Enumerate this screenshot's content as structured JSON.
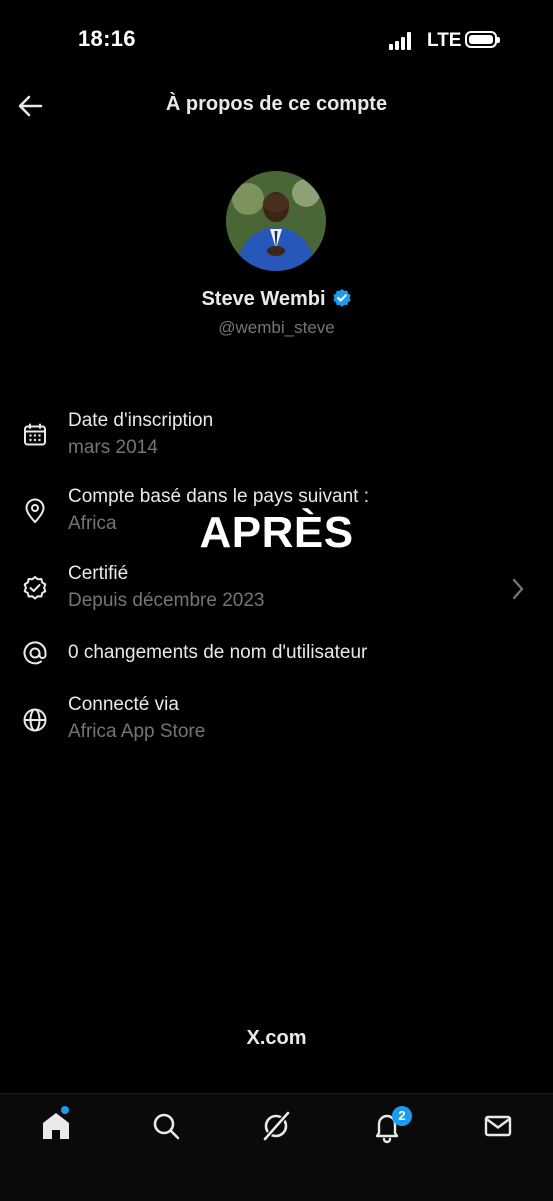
{
  "status_bar": {
    "time": "18:16",
    "network": "LTE"
  },
  "header": {
    "title": "À propos de ce compte",
    "back_icon": "arrow-left-icon"
  },
  "profile": {
    "name": "Steve Wembi",
    "handle": "@wembi_steve",
    "verified": true,
    "verified_color": "#1d9bf0"
  },
  "info_rows": [
    {
      "icon": "calendar-icon",
      "title": "Date d'inscription",
      "subtitle": "mars 2014"
    },
    {
      "icon": "location-pin-icon",
      "title": "Compte basé dans le pays suivant :",
      "subtitle": "Africa"
    },
    {
      "icon": "verified-badge-icon",
      "title": "Certifié",
      "subtitle": "Depuis décembre 2023"
    },
    {
      "icon": "at-sign-icon",
      "title": "0 changements de nom d'utilisateur",
      "subtitle": ""
    },
    {
      "icon": "globe-icon",
      "title": "Connecté via",
      "subtitle": "Africa App Store"
    }
  ],
  "overlay_text": "APRÈS",
  "footer_brand": "X.com",
  "bottom_nav": {
    "items": [
      "home-icon",
      "search-icon",
      "grok-icon",
      "bell-icon",
      "mail-icon"
    ],
    "notifications_count": "2"
  },
  "colors": {
    "background": "#000000",
    "text_primary": "#e7e9ea",
    "text_secondary": "#71767b",
    "accent": "#1d9bf0"
  }
}
